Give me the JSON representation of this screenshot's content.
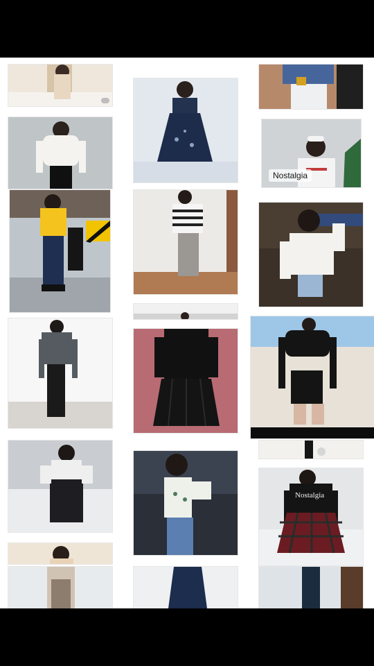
{
  "gallery": {
    "items": [
      {
        "label": ""
      },
      {
        "label": ""
      },
      {
        "label": ""
      },
      {
        "label": ""
      },
      {
        "label": ""
      },
      {
        "label": ""
      },
      {
        "label": ""
      },
      {
        "label": ""
      },
      {
        "label": ""
      },
      {
        "label": ""
      },
      {
        "label": ""
      },
      {
        "label": ""
      },
      {
        "label": ""
      },
      {
        "label": ""
      },
      {
        "label": "Nostalgia"
      },
      {
        "label": ""
      },
      {
        "label": ""
      },
      {
        "label": ""
      }
    ]
  },
  "colors": {
    "background": "#ffffff",
    "bars": "#000000"
  }
}
